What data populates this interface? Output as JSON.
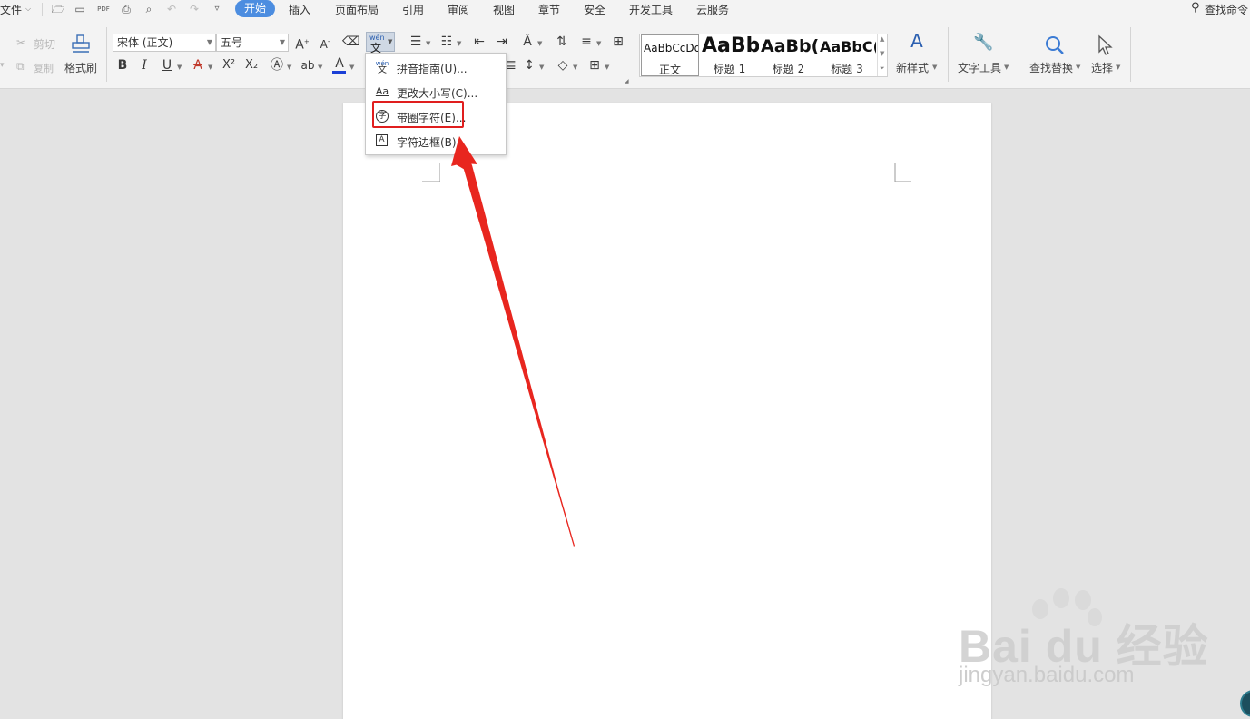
{
  "menubar": {
    "file_label": "文件",
    "tabs": [
      "开始",
      "插入",
      "页面布局",
      "引用",
      "审阅",
      "视图",
      "章节",
      "安全",
      "开发工具",
      "云服务"
    ],
    "search_command": "查找命令"
  },
  "clipboard": {
    "cut_label": "剪切",
    "copy_label": "复制",
    "format_painter_label": "格式刷"
  },
  "font": {
    "family_value": "宋体 (正文)",
    "size_value": "五号"
  },
  "styles": {
    "items": [
      {
        "preview": "AaBbCcDd",
        "label": "正文"
      },
      {
        "preview": "AaBb",
        "label": "标题 1"
      },
      {
        "preview": "AaBb(",
        "label": "标题 2"
      },
      {
        "preview": "AaBbC(",
        "label": "标题 3"
      }
    ],
    "new_style_label": "新样式"
  },
  "tools": {
    "text_tools_label": "文字工具",
    "find_replace_label": "查找替换",
    "select_label": "选择"
  },
  "dropdown": {
    "items": [
      {
        "label": "拼音指南(U)...",
        "icon": "pinyin-guide-icon"
      },
      {
        "label": "更改大小写(C)...",
        "icon": "change-case-icon"
      },
      {
        "label": "带圈字符(E)...",
        "icon": "enclosed-character-icon"
      },
      {
        "label": "字符边框(B)",
        "icon": "character-border-icon"
      }
    ]
  },
  "watermark": {
    "brand": "Bai du 经验",
    "url": "jingyan.baidu.com"
  },
  "colors": {
    "active_tab": "#4c8de0",
    "annotation_red": "#e01e1e",
    "font_color_underline": "#1a3fd6"
  }
}
